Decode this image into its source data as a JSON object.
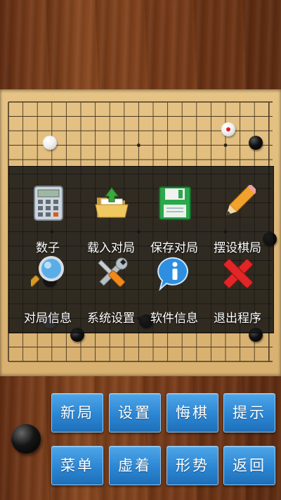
{
  "menu": {
    "items": [
      {
        "label": "数子",
        "icon": "calculator-icon"
      },
      {
        "label": "载入对局",
        "icon": "folder-open-icon"
      },
      {
        "label": "保存对局",
        "icon": "save-floppy-icon"
      },
      {
        "label": "摆设棋局",
        "icon": "pencil-icon"
      },
      {
        "label": "对局信息",
        "icon": "magnifier-icon"
      },
      {
        "label": "系统设置",
        "icon": "tools-icon"
      },
      {
        "label": "软件信息",
        "icon": "info-icon"
      },
      {
        "label": "退出程序",
        "icon": "close-x-icon"
      }
    ]
  },
  "buttons": {
    "row1": [
      "新局",
      "设置",
      "悔棋",
      "提示"
    ],
    "row2": [
      "菜单",
      "虚着",
      "形势",
      "返回"
    ]
  },
  "board": {
    "size": 19,
    "stones": [
      {
        "color": "white",
        "col": 4,
        "row": 4
      },
      {
        "color": "white",
        "col": 17,
        "row": 3,
        "last_move": true
      },
      {
        "color": "black",
        "col": 19,
        "row": 4
      },
      {
        "color": "black",
        "col": 20,
        "row": 11
      },
      {
        "color": "black",
        "col": 4,
        "row": 14
      },
      {
        "color": "white",
        "col": 4,
        "row": 17
      },
      {
        "color": "black",
        "col": 6,
        "row": 18
      },
      {
        "color": "black",
        "col": 11,
        "row": 17
      },
      {
        "color": "black",
        "col": 19,
        "row": 18
      }
    ],
    "current_turn": "black"
  }
}
